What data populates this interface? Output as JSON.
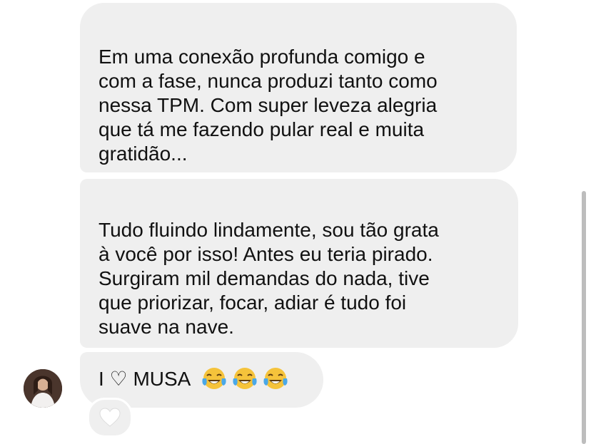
{
  "conversation": {
    "messages": [
      {
        "text": "Em uma conexão profunda comigo e\ncom a fase, nunca produzi tanto como\nnessa TPM. Com super leveza alegria\nque tá me fazendo pular real e muita\ngratidão..."
      },
      {
        "text": "Tudo fluindo lindamente, sou tão grata\nà você por isso! Antes eu teria pirado.\nSurgiram mil demandas do nada, tive\nque priorizar, focar, adiar é tudo foi\nsuave na nave."
      },
      {
        "text": "I ♡ MUSA",
        "emojis": [
          "face-with-tears-of-joy",
          "face-with-tears-of-joy",
          "face-with-tears-of-joy"
        ]
      }
    ],
    "reaction": {
      "icon": "heart-icon",
      "color": "#ffffff"
    },
    "avatar": {
      "icon": "user-avatar"
    }
  },
  "colors": {
    "bubble_bg": "#efefef",
    "text": "#111111",
    "emoji_face": "#f5c33b",
    "emoji_tears": "#4aa8e8"
  }
}
